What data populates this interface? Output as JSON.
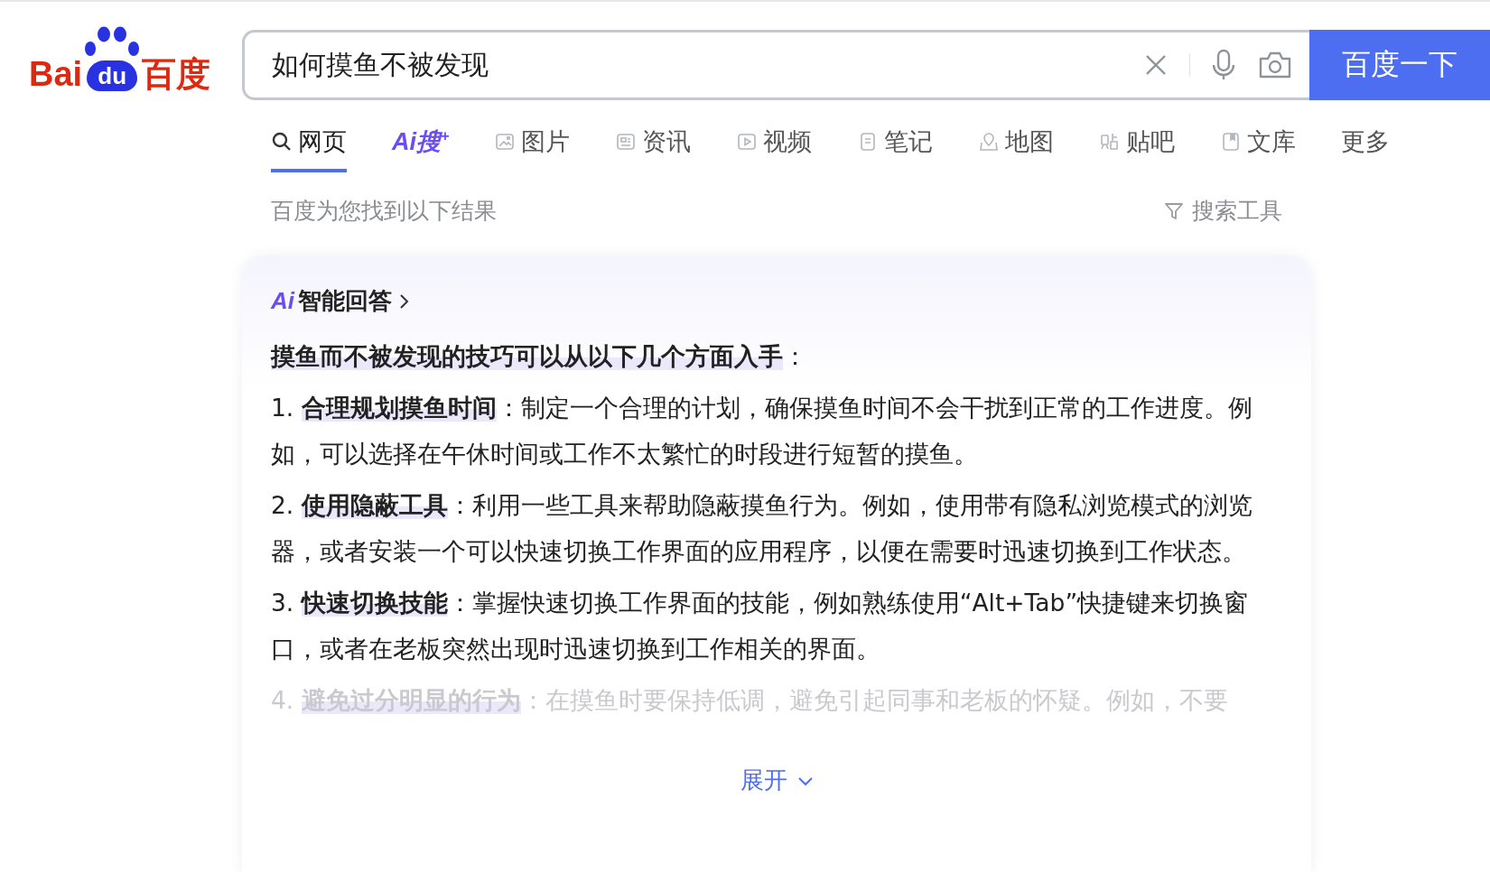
{
  "logo": {
    "left": "Bai",
    "paw": "du",
    "right": "百度"
  },
  "search": {
    "value": "如何摸鱼不被发现",
    "button": "百度一下"
  },
  "tabs": [
    {
      "label": "网页",
      "kind": "search",
      "selected": true
    },
    {
      "label": "Ai搜$^{+}$",
      "kind": "ai",
      "selected": false
    },
    {
      "label": "图片",
      "kind": "image",
      "selected": false
    },
    {
      "label": "资讯",
      "kind": "news",
      "selected": false
    },
    {
      "label": "视频",
      "kind": "video",
      "selected": false
    },
    {
      "label": "笔记",
      "kind": "note",
      "selected": false
    },
    {
      "label": "地图",
      "kind": "map",
      "selected": false
    },
    {
      "label": "贴吧",
      "kind": "tieba",
      "selected": false
    },
    {
      "label": "文库",
      "kind": "library",
      "selected": false
    },
    {
      "label": "更多",
      "kind": "plain",
      "selected": false
    }
  ],
  "result_note": "百度为您找到以下结果",
  "search_tools": "搜索工具",
  "ai_answer": {
    "badge": "Ai",
    "title": "智能回答",
    "intro": "**摸鱼而不被发现的技巧可以从以下几个方面入手**：",
    "items": [
      {
        "text": "1. **合理规划摸鱼时间**：制定一个合理的计划，确保摸鱼时间不会干扰到正常的工作进度。例如，可以选择在午休时间或工作不太繁忙的时段进行短暂的摸鱼。",
        "faded": false
      },
      {
        "text": "2. **使用隐蔽工具**：利用一些工具来帮助隐蔽摸鱼行为。例如，使用带有隐私浏览模式的浏览器，或者安装一个可以快速切换工作界面的应用程序，以便在需要时迅速切换到工作状态。",
        "faded": false
      },
      {
        "text": "3. **快速切换技能**：掌握快速切换工作界面的技能，例如熟练使用“Alt+Tab”快捷键来切换窗口，或者在老板突然出现时迅速切换到工作相关的界面。",
        "faded": false
      },
      {
        "text": "4. **避免过分明显的行为**：在摸鱼时要保持低调，避免引起同事和老板的怀疑。例如，不要",
        "faded": true
      }
    ],
    "expand": "展开"
  }
}
